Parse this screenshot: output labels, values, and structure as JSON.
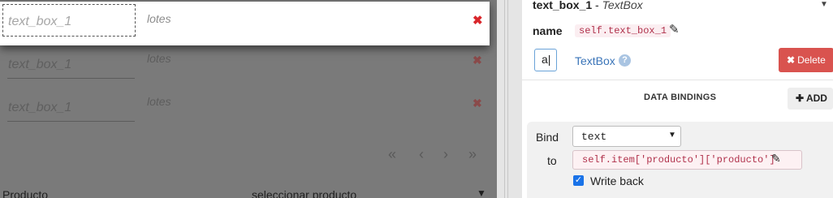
{
  "canvas": {
    "rows": [
      {
        "textbox_placeholder": "text_box_1",
        "lotes": "lotes",
        "delete_icon": "✖"
      },
      {
        "textbox_placeholder": "text_box_1",
        "lotes": "lotes",
        "delete_icon": "✖"
      },
      {
        "textbox_placeholder": "text_box_1",
        "lotes": "lotes",
        "delete_icon": "✖"
      }
    ],
    "pager": {
      "first": "«",
      "prev": "‹",
      "next": "›",
      "last": "»"
    },
    "bottom_label": "Producto",
    "bottom_select": "seleccionar producto",
    "bottom_caret": "▼"
  },
  "panel": {
    "title_name": "text_box_1",
    "title_sep": " - ",
    "title_type": "TextBox",
    "title_caret": "▼",
    "name_label": "name",
    "name_value": "self.text_box_1",
    "edit_icon": "✎",
    "type_icon_text": "a|",
    "type_name": "TextBox",
    "help_icon": "?",
    "delete_icon": "✖",
    "delete_label": "Delete",
    "data_bindings_header": "DATA BINDINGS",
    "add_icon": "✚",
    "add_label": "ADD",
    "binding": {
      "bind_label": "Bind",
      "bind_value": "text",
      "to_label": "to",
      "to_value": "self.item['producto']['producto']",
      "writeback_label": "Write back",
      "writeback_checked": true
    }
  },
  "colors": {
    "delete": "#d9534f",
    "accent": "#1a73e8",
    "code": "#b0314b"
  }
}
